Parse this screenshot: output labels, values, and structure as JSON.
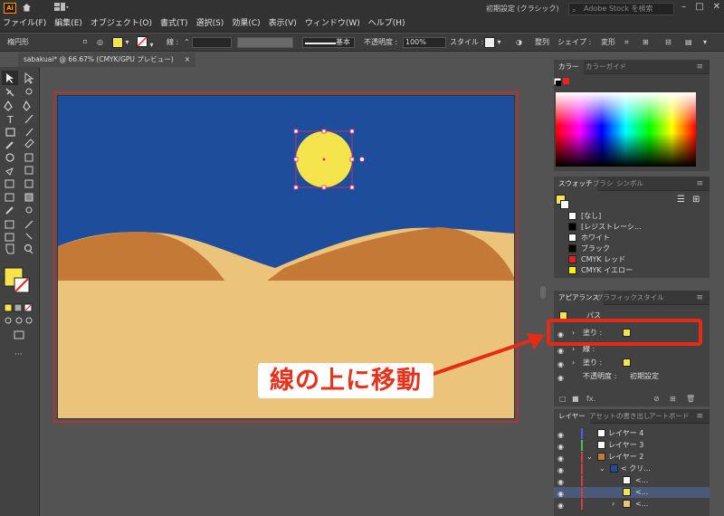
{
  "app": {
    "logo": "Ai",
    "workspace_name": "初期設定 (クラシック)",
    "stock_search_placeholder": "Adobe Stock を検索"
  },
  "menu": [
    "ファイル(F)",
    "編集(E)",
    "オブジェクト(O)",
    "書式(T)",
    "選択(S)",
    "効果(C)",
    "表示(V)",
    "ウィンドウ(W)",
    "ヘルプ(H)"
  ],
  "control_bar": {
    "selection_label": "楕円形",
    "stroke_label": "線 :",
    "stroke_profile": "基本",
    "opacity_label": "不透明度 :",
    "opacity_value": "100%",
    "style_label": "スタイル :",
    "align_label": "整列",
    "shape_label": "シェイプ :",
    "transform_label": "変形"
  },
  "document_tab": {
    "title": "sabakuai* @ 66.67% (CMYK/GPU プレビュー)",
    "close": "×"
  },
  "color_panel": {
    "tabs": [
      "カラー",
      "カラーガイド"
    ]
  },
  "swatches_panel": {
    "tabs": [
      "スウォッチ",
      "ブラシ",
      "シンボル"
    ],
    "items": [
      {
        "name": "[なし]",
        "color": "#ffffff"
      },
      {
        "name": "[レジストレーシ...",
        "color": "#000000"
      },
      {
        "name": "ホワイト",
        "color": "#ffffff"
      },
      {
        "name": "ブラック",
        "color": "#000000"
      },
      {
        "name": "CMYK レッド",
        "color": "#e31e24"
      },
      {
        "name": "CMYK イエロー",
        "color": "#fff200"
      }
    ]
  },
  "appearance_panel": {
    "tabs": [
      "アピアランス",
      "グラフィックスタイル"
    ],
    "path_label": "パス",
    "rows": [
      {
        "label": "塗り :",
        "swatch": "#f5e44b"
      },
      {
        "label": "線 :",
        "swatch": "none"
      },
      {
        "label": "塗り :",
        "swatch": "#f5e44b"
      },
      {
        "label": "不透明度 :",
        "value": "初期設定"
      }
    ]
  },
  "layers_panel": {
    "tabs": [
      "レイヤー",
      "アセットの書き出し",
      "アートボード"
    ],
    "items": [
      {
        "name": "レイヤー 4",
        "indent": 0,
        "color": "#4b5bff"
      },
      {
        "name": "レイヤー 3",
        "indent": 0,
        "color": "#49c24a"
      },
      {
        "name": "レイヤー 2",
        "indent": 0,
        "color": "#d04040"
      },
      {
        "name": "< クリ...",
        "indent": 1,
        "color": "#d04040"
      },
      {
        "name": "<...",
        "indent": 2,
        "color": "#d04040"
      },
      {
        "name": "<...",
        "indent": 2,
        "color": "#d04040"
      },
      {
        "name": "<...",
        "indent": 2,
        "color": "#d04040"
      }
    ]
  },
  "annotation": {
    "text": "線の上に移動",
    "color": "#e8311b"
  },
  "colors": {
    "sky": "#1e4d9c",
    "sand": "#ecc37a",
    "dune_dark": "#c47a36",
    "sun": "#f5e44b",
    "selection": "#e0306e"
  }
}
